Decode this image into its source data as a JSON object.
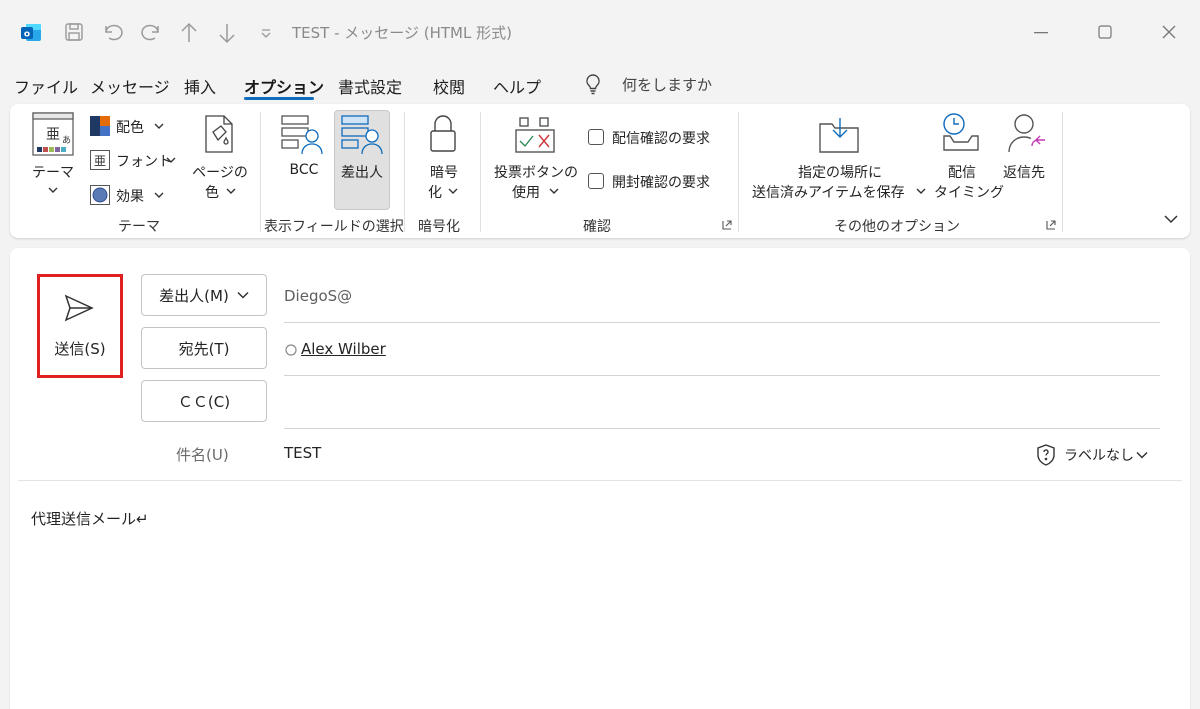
{
  "window": {
    "title": "TEST  -  メッセージ (HTML 形式)"
  },
  "menu": {
    "items": [
      "ファイル",
      "メッセージ",
      "挿入",
      "オプション",
      "書式設定",
      "校閲",
      "ヘルプ"
    ],
    "active_index": 3,
    "tell_me": "何をしますか"
  },
  "ribbon": {
    "theme": {
      "theme_label": "テーマ",
      "colors_label": "配色",
      "fonts_label": "フォント",
      "effects_label": "効果",
      "page_color_line1": "ページの",
      "page_color_line2": "色",
      "group_label": "テーマ"
    },
    "fields": {
      "bcc_label": "BCC",
      "from_label": "差出人",
      "group_label": "表示フィールドの選択"
    },
    "encrypt": {
      "line1": "暗号",
      "line2": "化",
      "group_label": "暗号化"
    },
    "tracking": {
      "voting_line1": "投票ボタンの",
      "voting_line2": "使用",
      "delivery_receipt": "配信確認の要求",
      "read_receipt": "開封確認の要求",
      "group_label": "確認"
    },
    "more": {
      "save_line1": "指定の場所に",
      "save_line2": "送信済みアイテムを保存",
      "delay_line1": "配信",
      "delay_line2": "タイミング",
      "reply_to": "返信先",
      "group_label": "その他のオプション"
    }
  },
  "compose": {
    "send_label": "送信(S)",
    "from_button": "差出人(M)",
    "from_value": "DiegoS@",
    "to_button": "宛先(T)",
    "to_recipient": "Alex Wilber",
    "cc_button": "ＣＣ(C)",
    "cc_value": "",
    "subject_label": "件名(U)",
    "subject_value": "TEST",
    "sensitivity_label": "ラベルなし",
    "body_text": "代理送信メール↵"
  },
  "colors": {
    "accent": "#0f6cbd",
    "highlight_border": "#e02020",
    "outlook_blue": "#0364b8"
  }
}
